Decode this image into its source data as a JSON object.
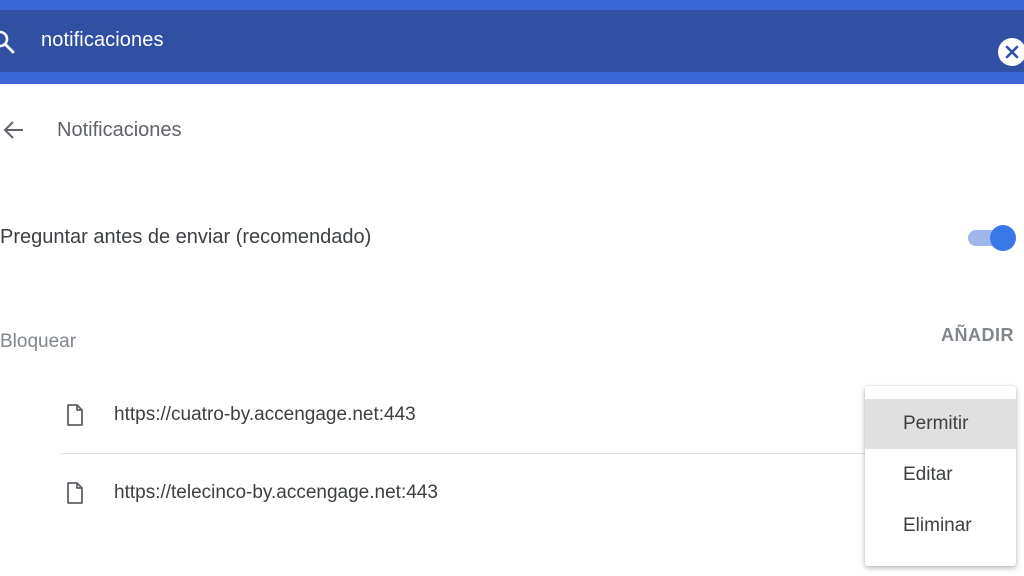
{
  "search": {
    "value": "notificaciones",
    "icon": "search-icon",
    "clear_icon": "close-icon"
  },
  "header": {
    "title": "Notificaciones",
    "back_icon": "arrow-back-icon"
  },
  "ask_before_sending": {
    "label": "Preguntar antes de enviar (recomendado)",
    "enabled": true
  },
  "block_section": {
    "label": "Bloquear",
    "add_label": "AÑADIR",
    "sites": [
      {
        "url": "https://cuatro-by.accengage.net:443",
        "icon": "file-icon"
      },
      {
        "url": "https://telecinco-by.accengage.net:443",
        "icon": "file-icon"
      }
    ]
  },
  "context_menu": {
    "items": [
      {
        "label": "Permitir",
        "highlighted": true
      },
      {
        "label": "Editar",
        "highlighted": false
      },
      {
        "label": "Eliminar",
        "highlighted": false
      }
    ]
  },
  "colors": {
    "search_bar": "#3050a4",
    "accent_strip": "#3b66d6",
    "toggle_on": "#3b78e7"
  }
}
